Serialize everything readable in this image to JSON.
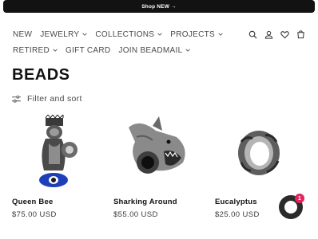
{
  "announcement": "Shop NEW →",
  "nav": {
    "row1": [
      {
        "label": "NEW",
        "dropdown": false
      },
      {
        "label": "JEWELRY",
        "dropdown": true
      },
      {
        "label": "COLLECTIONS",
        "dropdown": true
      },
      {
        "label": "PROJECTS",
        "dropdown": true
      }
    ],
    "row2": [
      {
        "label": "RETIRED",
        "dropdown": true
      },
      {
        "label": "GIFT CARD",
        "dropdown": false
      },
      {
        "label": "JOIN BEADMAIL",
        "dropdown": true
      }
    ]
  },
  "header_icons": [
    "search-icon",
    "account-icon",
    "wishlist-heart-icon",
    "cart-icon"
  ],
  "page_title": "BEADS",
  "filter_label": "Filter and sort",
  "products": [
    {
      "name": "Queen Bee",
      "price": "$75.00 USD"
    },
    {
      "name": "Sharking Around",
      "price": "$55.00 USD"
    },
    {
      "name": "Eucalyptus",
      "price": "$25.00 USD"
    }
  ],
  "chat": {
    "badge": "1",
    "accent": "#e0245e"
  }
}
